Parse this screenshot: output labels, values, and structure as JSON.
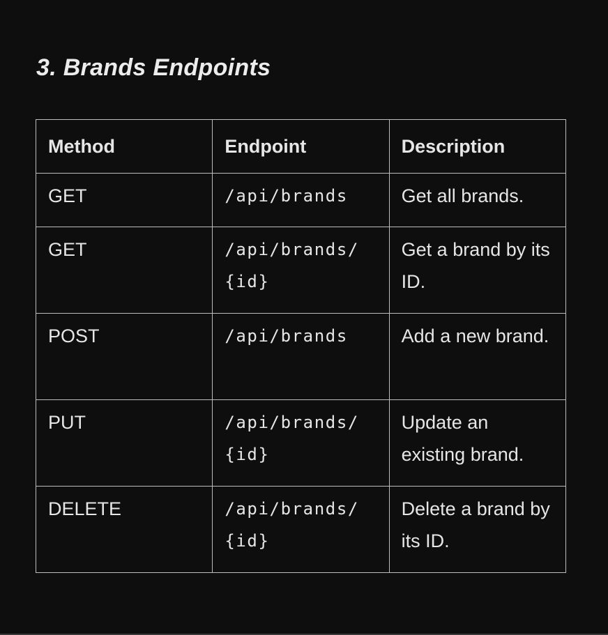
{
  "heading": "3. Brands Endpoints",
  "table": {
    "headers": [
      "Method",
      "Endpoint",
      "Description"
    ],
    "rows": [
      {
        "method": "GET",
        "endpoint": "/api/brands",
        "description": "Get all brands."
      },
      {
        "method": "GET",
        "endpoint": "/api/brands/{id}",
        "description": "Get a brand by its ID."
      },
      {
        "method": "POST",
        "endpoint": "/api/brands",
        "description": "Add a new brand."
      },
      {
        "method": "PUT",
        "endpoint": "/api/brands/{id}",
        "description": "Update an existing brand."
      },
      {
        "method": "DELETE",
        "endpoint": "/api/brands/{id}",
        "description": "Delete a brand by its ID."
      }
    ]
  }
}
